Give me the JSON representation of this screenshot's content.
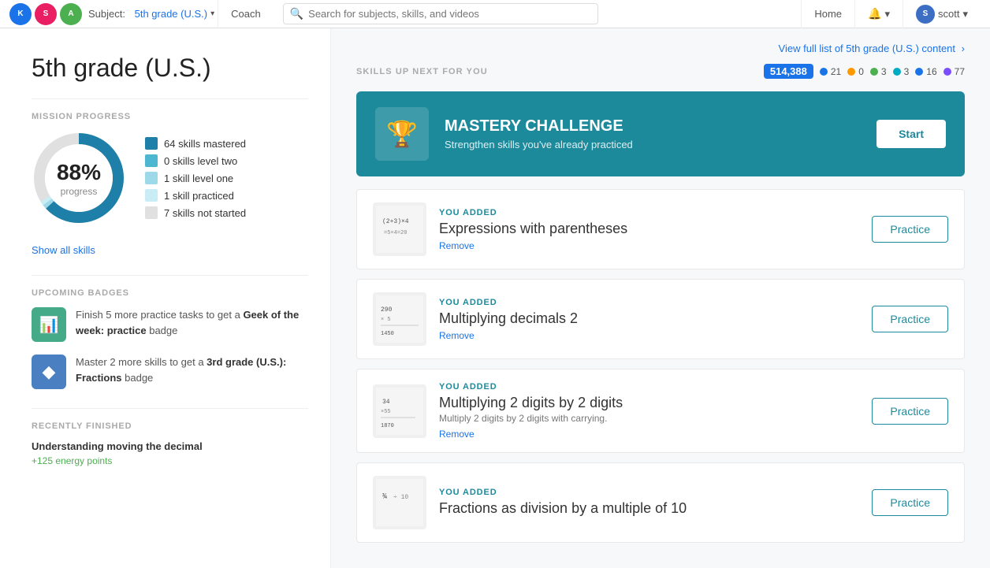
{
  "nav": {
    "subject_label": "Subject:",
    "subject_value": "5th grade (U.S.)",
    "coach_label": "Coach",
    "search_placeholder": "Search for subjects, skills, and videos",
    "home_label": "Home",
    "user_name": "scott",
    "view_full_link": "View full list of 5th grade (U.S.) content"
  },
  "sidebar": {
    "page_title": "5th grade (U.S.)",
    "mission_progress_label": "MISSION PROGRESS",
    "progress_pct": "88%",
    "progress_word": "progress",
    "legend": [
      {
        "label": "64 skills mastered",
        "color_class": "lc-dark-teal"
      },
      {
        "label": "0 skills level two",
        "color_class": "lc-mid-teal"
      },
      {
        "label": "1 skill level one",
        "color_class": "lc-light-teal"
      },
      {
        "label": "1 skill practiced",
        "color_class": "lc-pale-teal"
      },
      {
        "label": "7 skills not started",
        "color_class": "lc-gray"
      }
    ],
    "show_all_skills": "Show all skills",
    "upcoming_badges_label": "UPCOMING BADGES",
    "badges": [
      {
        "icon_type": "green-badge",
        "icon_symbol": "📊",
        "text_before": "Finish 5 more practice tasks to get a ",
        "text_bold": "Geek of the week: practice",
        "text_after": " badge"
      },
      {
        "icon_type": "blue-badge",
        "icon_symbol": "🔷",
        "text_before": "Master 2 more skills to get a ",
        "text_bold": "3rd grade (U.S.): Fractions",
        "text_after": " badge"
      }
    ],
    "recently_finished_label": "RECENTLY FINISHED",
    "recently_title": "Understanding moving the decimal",
    "recently_points": "+125 energy points"
  },
  "main": {
    "skills_up_label": "SKILLS UP NEXT FOR YOU",
    "energy_points": "514,388",
    "stats": [
      {
        "dot_class": "dot-blue",
        "value": "21"
      },
      {
        "dot_class": "dot-orange",
        "value": "0"
      },
      {
        "dot_class": "dot-green",
        "value": "3"
      },
      {
        "dot_class": "dot-teal",
        "value": "3"
      },
      {
        "dot_class": "dot-blue",
        "value": "16"
      },
      {
        "dot_class": "dot-purple",
        "value": "77"
      }
    ],
    "mastery": {
      "title": "MASTERY CHALLENGE",
      "subtitle": "Strengthen skills you've already practiced",
      "start_label": "Start"
    },
    "skills": [
      {
        "you_added": "YOU ADDED",
        "name": "Expressions with parentheses",
        "desc": "",
        "remove": "Remove",
        "practice": "Practice",
        "thumb_type": "expr"
      },
      {
        "you_added": "YOU ADDED",
        "name": "Multiplying decimals 2",
        "desc": "",
        "remove": "Remove",
        "practice": "Practice",
        "thumb_type": "mult-dec"
      },
      {
        "you_added": "YOU ADDED",
        "name": "Multiplying 2 digits by 2 digits",
        "desc": "Multiply 2 digits by 2 digits with carrying.",
        "remove": "Remove",
        "practice": "Practice",
        "thumb_type": "mult-2"
      },
      {
        "you_added": "YOU ADDED",
        "name": "Fractions as division by a multiple of 10",
        "desc": "",
        "remove": "",
        "practice": "Practice",
        "thumb_type": "frac"
      }
    ]
  },
  "donut": {
    "segments": [
      {
        "pct": 88,
        "color": "#1e7fa8"
      },
      {
        "pct": 0,
        "color": "#4db6d0"
      },
      {
        "pct": 1.5,
        "color": "#9dd9e8"
      },
      {
        "pct": 1.5,
        "color": "#c8edf5"
      },
      {
        "pct": 9,
        "color": "#e0e0e0"
      }
    ]
  }
}
